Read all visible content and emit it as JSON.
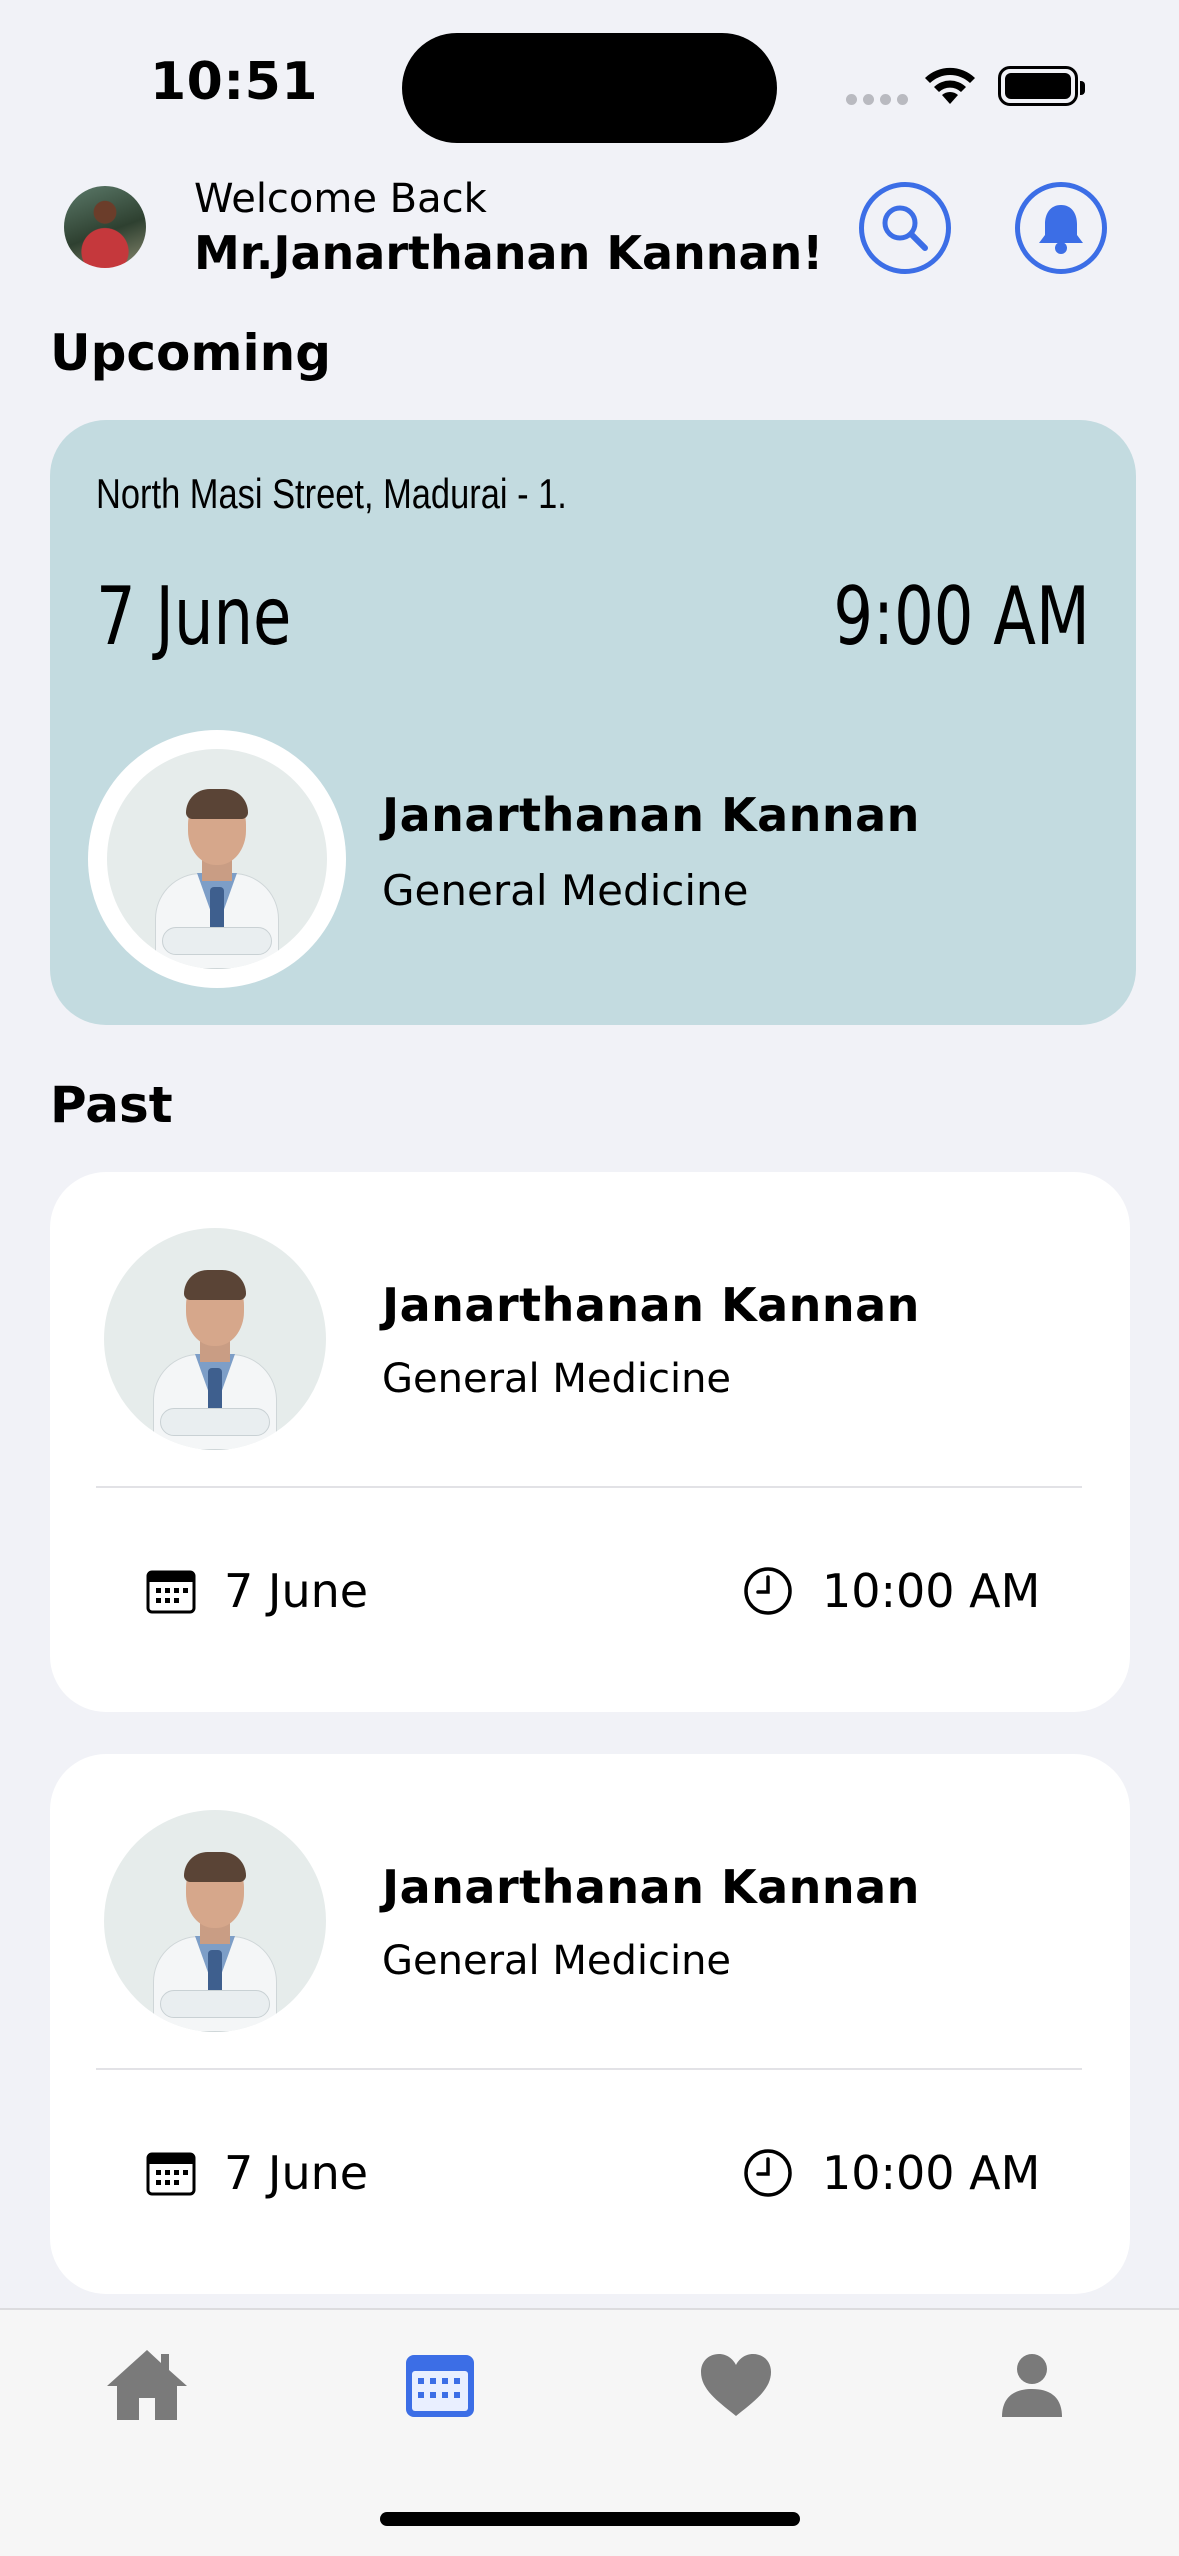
{
  "status_bar": {
    "time": "10:51"
  },
  "header": {
    "welcome": "Welcome Back",
    "user_name": "Mr.Janarthanan Kannan!",
    "avatar_icon": "user-avatar",
    "search_icon": "search-icon",
    "bell_icon": "bell-icon",
    "accent": "#3c6ee6"
  },
  "upcoming": {
    "title": "Upcoming",
    "address": "North Masi Street, Madurai - 1.",
    "date": "7 June",
    "time": "9:00 AM",
    "doctor_name": "Janarthanan Kannan",
    "specialty": "General Medicine",
    "card_color": "#c3dbe0"
  },
  "past": {
    "title": "Past",
    "items": [
      {
        "doctor_name": "Janarthanan Kannan",
        "specialty": "General Medicine",
        "date": "7 June",
        "time": "10:00 AM"
      },
      {
        "doctor_name": "Janarthanan Kannan",
        "specialty": "General Medicine",
        "date": "7 June",
        "time": "10:00 AM"
      }
    ]
  },
  "tabbar": {
    "tabs": [
      {
        "icon": "home-icon",
        "active": false
      },
      {
        "icon": "calendar-icon",
        "active": true
      },
      {
        "icon": "heart-icon",
        "active": false
      },
      {
        "icon": "profile-icon",
        "active": false
      }
    ],
    "active_color": "#3c6ee6",
    "inactive_color": "#7a7a7a"
  }
}
